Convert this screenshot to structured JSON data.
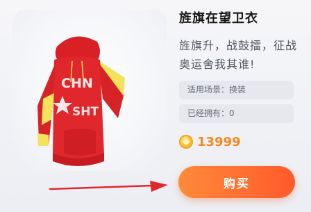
{
  "item": {
    "title": "旌旗在望卫衣",
    "description": "旌旗升，战鼓擂，征战奥运舍我其谁!",
    "scene_label": "适用场景：换装",
    "owned_label": "已经拥有：0",
    "price": "13999",
    "currency_icon": "coin-icon"
  },
  "actions": {
    "buy_label": "购买"
  },
  "colors": {
    "accent": "#ff6a2c",
    "price": "#f08a1e",
    "hoodie_red": "#e0282c",
    "hoodie_yellow": "#f3e35a",
    "annotation_arrow": "#e0282c"
  }
}
